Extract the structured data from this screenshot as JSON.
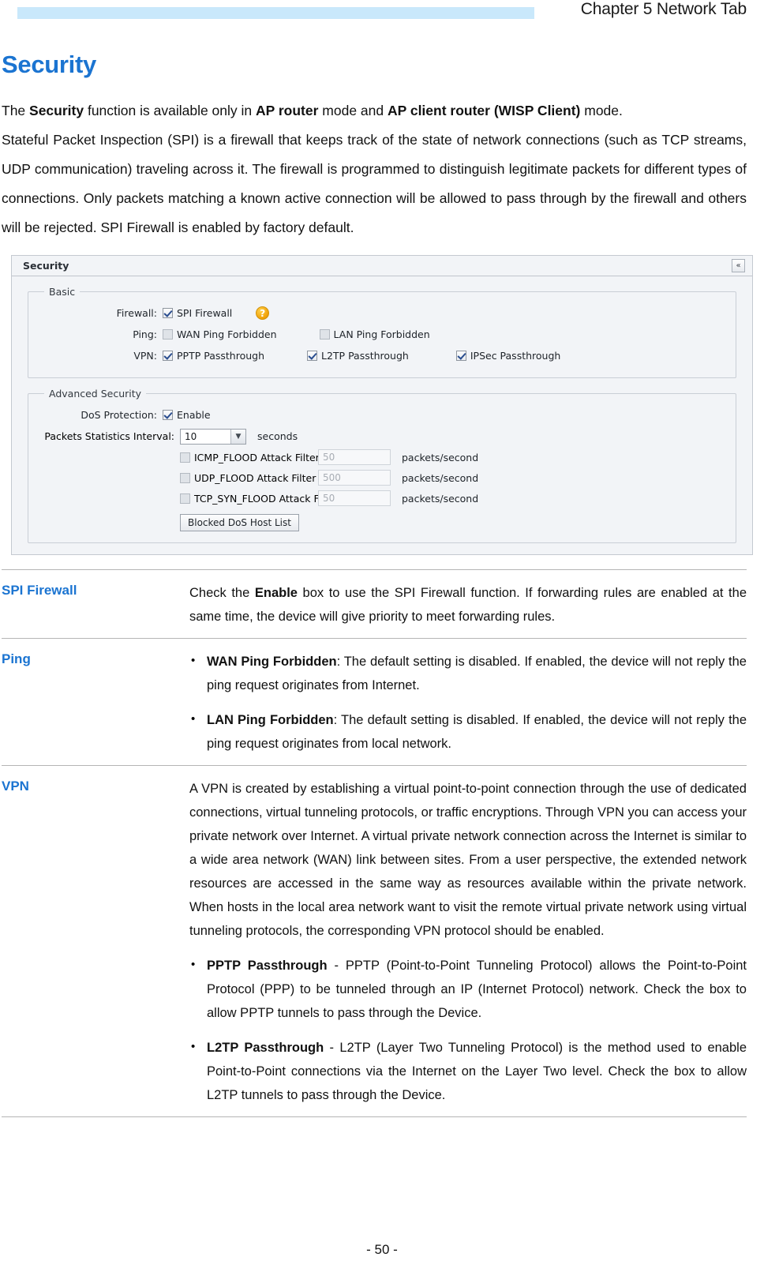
{
  "header": {
    "chapter_title": "Chapter 5 Network Tab",
    "band_color": "#c9e8fb"
  },
  "page": {
    "section_title": "Security",
    "footer": "- 50 -",
    "accent_color": "#1b74d1"
  },
  "intro": {
    "line1_prefix": "The ",
    "line1_b1": "Security",
    "line1_mid1": " function is available only in ",
    "line1_b2": "AP router",
    "line1_mid2": " mode and ",
    "line1_b3": "AP client router (WISP Client)",
    "line1_suffix": " mode.",
    "paragraph": "Stateful Packet Inspection (SPI) is a firewall that keeps track of the state of network connections (such as TCP streams, UDP communication) traveling across it. The firewall is programmed to distinguish legitimate packets for different types of connections. Only packets matching a known active connection will be allowed to pass through by the firewall and others will be rejected. SPI Firewall is enabled by factory default."
  },
  "screenshot": {
    "title": "Security",
    "collapse_icon": "«",
    "basic": {
      "legend": "Basic",
      "firewall_label": "Firewall:",
      "firewall_checkbox": {
        "label": "SPI Firewall",
        "checked": true
      },
      "help_glyph": "?",
      "ping_label": "Ping:",
      "ping_checkboxes": [
        {
          "label": "WAN Ping Forbidden",
          "checked": false
        },
        {
          "label": "LAN Ping Forbidden",
          "checked": false
        }
      ],
      "vpn_label": "VPN:",
      "vpn_checkboxes": [
        {
          "label": "PPTP Passthrough",
          "checked": true
        },
        {
          "label": "L2TP Passthrough",
          "checked": true
        },
        {
          "label": "IPSec Passthrough",
          "checked": true
        }
      ]
    },
    "advanced": {
      "legend": "Advanced Security",
      "dos_label": "DoS Protection:",
      "dos_checkbox": {
        "label": "Enable",
        "checked": true
      },
      "interval_label": "Packets Statistics Interval:",
      "interval_value": "10",
      "interval_units": "seconds",
      "filters": [
        {
          "label": "ICMP_FLOOD Attack Filter",
          "checked": false,
          "value": "50",
          "units": "packets/second"
        },
        {
          "label": "UDP_FLOOD Attack Filter",
          "checked": false,
          "value": "500",
          "units": "packets/second"
        },
        {
          "label": "TCP_SYN_FLOOD Attack Filter",
          "checked": false,
          "value": "50",
          "units": "packets/second"
        }
      ],
      "blocked_button": "Blocked DoS Host List"
    }
  },
  "definitions": {
    "spi": {
      "term": "SPI Firewall",
      "text_prefix": "Check the ",
      "text_bold": "Enable",
      "text_suffix": " box to use the SPI Firewall function. If forwarding rules are enabled at the same time, the device will give priority to meet forwarding rules."
    },
    "ping": {
      "term": "Ping",
      "items": [
        {
          "bold": "WAN Ping Forbidden",
          "text": ": The default setting is disabled. If enabled, the device will not reply the ping request originates from Internet."
        },
        {
          "bold": "LAN Ping Forbidden",
          "text": ": The default setting is disabled. If enabled, the device will not reply the ping request originates from local network."
        }
      ]
    },
    "vpn": {
      "term": "VPN",
      "paragraph": "A VPN is created by establishing a virtual point-to-point connection through the use of dedicated connections, virtual tunneling protocols, or traffic encryptions. Through VPN you can access your private network over Internet. A virtual private network connection across the Internet is similar to a wide area network (WAN) link between sites. From a user perspective, the extended network resources are accessed in the same way as resources available within the private network. When hosts in the local area network want to visit the remote virtual private network using virtual tunneling protocols, the corresponding VPN protocol should be enabled.",
      "items": [
        {
          "bold": "PPTP Passthrough",
          "text": " - PPTP (Point-to-Point Tunneling Protocol) allows the Point-to-Point Protocol (PPP) to be tunneled through an IP (Internet Protocol) network. Check the box to allow PPTP tunnels to pass through the Device."
        },
        {
          "bold": "L2TP Passthrough",
          "text": " - L2TP (Layer Two Tunneling Protocol) is the method used to enable Point-to-Point connections via the Internet on the Layer Two level. Check the box to allow L2TP tunnels to pass through the Device."
        }
      ]
    }
  }
}
